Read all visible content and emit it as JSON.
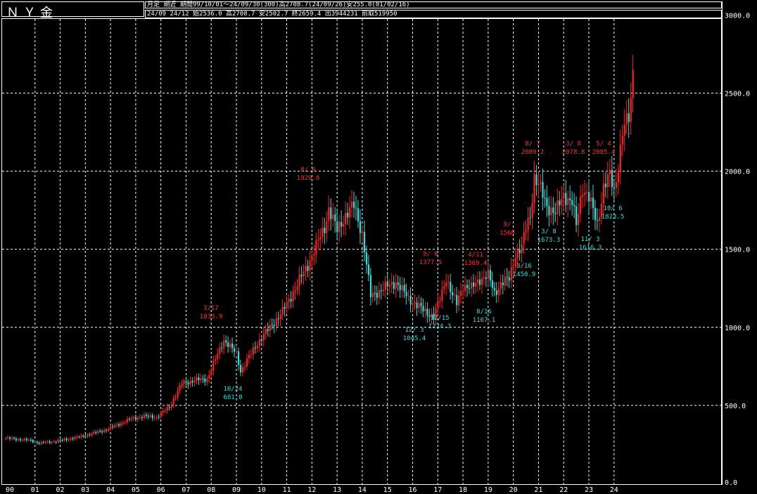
{
  "header": {
    "title": "ＮＹ金",
    "info_line1": "月足 期近 期間99/10/01～24/09/30(300)高2708.7(24/09/26)安255.0(01/02/16)",
    "info_line2": "24/09 24/12 始2536.0 高2708.7 安2502.7 終2659.4 出3944231 前取519950"
  },
  "colors": {
    "background": "#000000",
    "up": "#ff2020",
    "down": "#33dddd",
    "grid": "#ffffff",
    "high_label": "#ff3333",
    "low_label": "#33dddd"
  },
  "chart_data": {
    "type": "candlestick",
    "title": "ＮＹ金",
    "xlabel": "",
    "ylabel": "",
    "ylim": [
      0,
      3000
    ],
    "yticks": [
      0,
      500,
      1000,
      1500,
      2000,
      2500,
      3000
    ],
    "ytick_labels": [
      "0.0",
      "500.0",
      "1000.0",
      "1500.0",
      "2000.0",
      "2500.0",
      "3000.0"
    ],
    "xtick_labels": [
      "00",
      "01",
      "02",
      "03",
      "04",
      "05",
      "06",
      "07",
      "08",
      "09",
      "10",
      "11",
      "12",
      "13",
      "14",
      "15",
      "16",
      "17",
      "18",
      "19",
      "20",
      "21",
      "22",
      "23",
      "24"
    ],
    "grid": true,
    "monthly_close_anchors": [
      {
        "t": 0,
        "v": 290
      },
      {
        "t": 12,
        "v": 275
      },
      {
        "t": 16,
        "v": 258
      },
      {
        "t": 24,
        "v": 270
      },
      {
        "t": 36,
        "v": 300
      },
      {
        "t": 48,
        "v": 345
      },
      {
        "t": 60,
        "v": 415
      },
      {
        "t": 66,
        "v": 430
      },
      {
        "t": 72,
        "v": 425
      },
      {
        "t": 78,
        "v": 490
      },
      {
        "t": 84,
        "v": 640
      },
      {
        "t": 90,
        "v": 660
      },
      {
        "t": 96,
        "v": 670
      },
      {
        "t": 104,
        "v": 920
      },
      {
        "t": 110,
        "v": 830
      },
      {
        "t": 112,
        "v": 720
      },
      {
        "t": 120,
        "v": 900
      },
      {
        "t": 132,
        "v": 1100
      },
      {
        "t": 144,
        "v": 1400
      },
      {
        "t": 152,
        "v": 1640
      },
      {
        "t": 154,
        "v": 1760
      },
      {
        "t": 158,
        "v": 1620
      },
      {
        "t": 162,
        "v": 1720
      },
      {
        "t": 166,
        "v": 1780
      },
      {
        "t": 170,
        "v": 1600
      },
      {
        "t": 174,
        "v": 1200
      },
      {
        "t": 180,
        "v": 1250
      },
      {
        "t": 186,
        "v": 1290
      },
      {
        "t": 192,
        "v": 1185
      },
      {
        "t": 200,
        "v": 1100
      },
      {
        "t": 204,
        "v": 1070
      },
      {
        "t": 207,
        "v": 1180
      },
      {
        "t": 210,
        "v": 1320
      },
      {
        "t": 213,
        "v": 1200
      },
      {
        "t": 215,
        "v": 1150
      },
      {
        "t": 218,
        "v": 1270
      },
      {
        "t": 222,
        "v": 1250
      },
      {
        "t": 226,
        "v": 1310
      },
      {
        "t": 230,
        "v": 1330
      },
      {
        "t": 233,
        "v": 1220
      },
      {
        "t": 236,
        "v": 1280
      },
      {
        "t": 240,
        "v": 1310
      },
      {
        "t": 243,
        "v": 1470
      },
      {
        "t": 246,
        "v": 1510
      },
      {
        "t": 248,
        "v": 1640
      },
      {
        "t": 250,
        "v": 1720
      },
      {
        "t": 252,
        "v": 1960
      },
      {
        "t": 255,
        "v": 1880
      },
      {
        "t": 258,
        "v": 1780
      },
      {
        "t": 262,
        "v": 1730
      },
      {
        "t": 266,
        "v": 1850
      },
      {
        "t": 270,
        "v": 1800
      },
      {
        "t": 272,
        "v": 1650
      },
      {
        "t": 275,
        "v": 1900
      },
      {
        "t": 278,
        "v": 1830
      },
      {
        "t": 282,
        "v": 1660
      },
      {
        "t": 285,
        "v": 1900
      },
      {
        "t": 288,
        "v": 1970
      },
      {
        "t": 290,
        "v": 1870
      },
      {
        "t": 292,
        "v": 2040
      },
      {
        "t": 294,
        "v": 2250
      },
      {
        "t": 297,
        "v": 2340
      },
      {
        "t": 298,
        "v": 2450
      },
      {
        "t": 299,
        "v": 2659
      }
    ],
    "annotations": [
      {
        "kind": "high",
        "date": "3/17",
        "value": "1033.9"
      },
      {
        "kind": "low",
        "date": "10/24",
        "value": "681.0"
      },
      {
        "kind": "high",
        "date": "8/ 6",
        "value": "1920.8"
      },
      {
        "kind": "high",
        "date": "9/ 6",
        "value": "1377.5"
      },
      {
        "kind": "low",
        "date": "12/ 3",
        "value": "1045.4"
      },
      {
        "kind": "low",
        "date": "12/15",
        "value": "1124.3"
      },
      {
        "kind": "high",
        "date": "4/11",
        "value": "1369.4"
      },
      {
        "kind": "low",
        "date": "8/16",
        "value": "1167.1"
      },
      {
        "kind": "high",
        "date": "9/",
        "value": "1568"
      },
      {
        "kind": "low",
        "date": "3/16",
        "value": "1450.9"
      },
      {
        "kind": "high",
        "date": "8/ 7",
        "value": "2089.2"
      },
      {
        "kind": "low",
        "date": "3/ 8",
        "value": "1673.3"
      },
      {
        "kind": "high",
        "date": "3/ 8",
        "value": "2078.8"
      },
      {
        "kind": "low",
        "date": "11/ 3",
        "value": "1616.3"
      },
      {
        "kind": "high",
        "date": "5/ 4",
        "value": "2085.4"
      },
      {
        "kind": "low",
        "date": "10/ 6",
        "value": "1823.5"
      }
    ]
  }
}
